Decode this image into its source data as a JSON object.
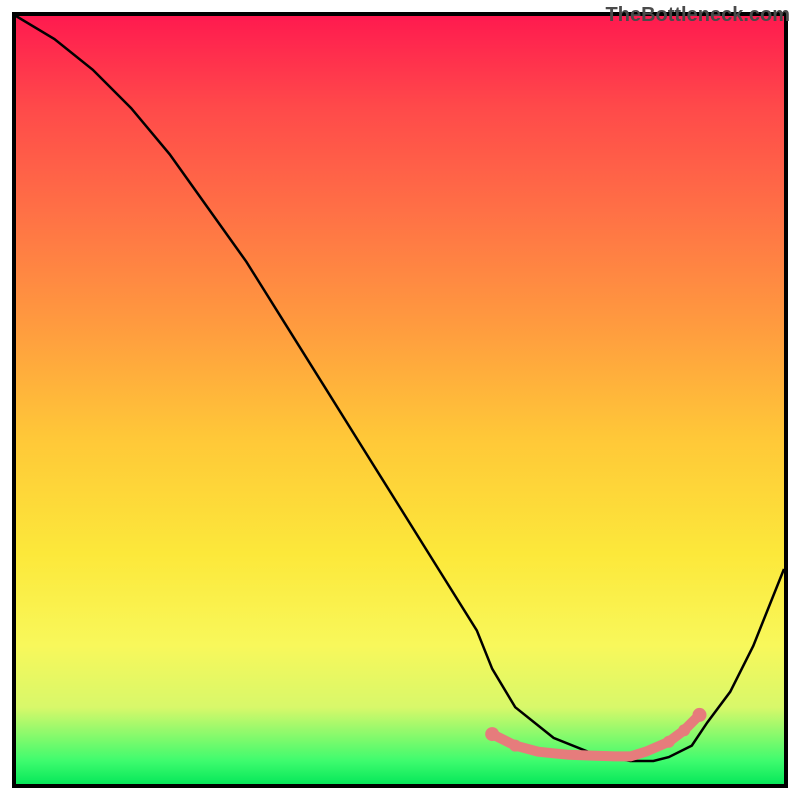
{
  "watermark": "TheBottleneck.com",
  "chart_data": {
    "type": "line",
    "title": "",
    "xlabel": "",
    "ylabel": "",
    "xlim": [
      0,
      100
    ],
    "ylim": [
      0,
      100
    ],
    "series": [
      {
        "name": "curve",
        "x": [
          0,
          5,
          10,
          15,
          20,
          25,
          30,
          35,
          40,
          45,
          50,
          55,
          60,
          62,
          65,
          70,
          75,
          80,
          83,
          85,
          88,
          90,
          93,
          96,
          100
        ],
        "y": [
          100,
          97,
          93,
          88,
          82,
          75,
          68,
          60,
          52,
          44,
          36,
          28,
          20,
          15,
          10,
          6,
          4,
          3,
          3,
          3.5,
          5,
          8,
          12,
          18,
          28
        ]
      }
    ],
    "highlight_segment": {
      "name": "minimum-band",
      "x": [
        62,
        65,
        68,
        70,
        72,
        75,
        78,
        80,
        82,
        85,
        87,
        89
      ],
      "y": [
        6.5,
        5,
        4.2,
        4,
        3.8,
        3.7,
        3.6,
        3.6,
        4.2,
        5.5,
        7,
        9
      ]
    },
    "colors": {
      "curve": "#000000",
      "highlight": "#e67c7c",
      "gradient_top": "#ff1a4f",
      "gradient_bottom": "#07e85a"
    }
  }
}
